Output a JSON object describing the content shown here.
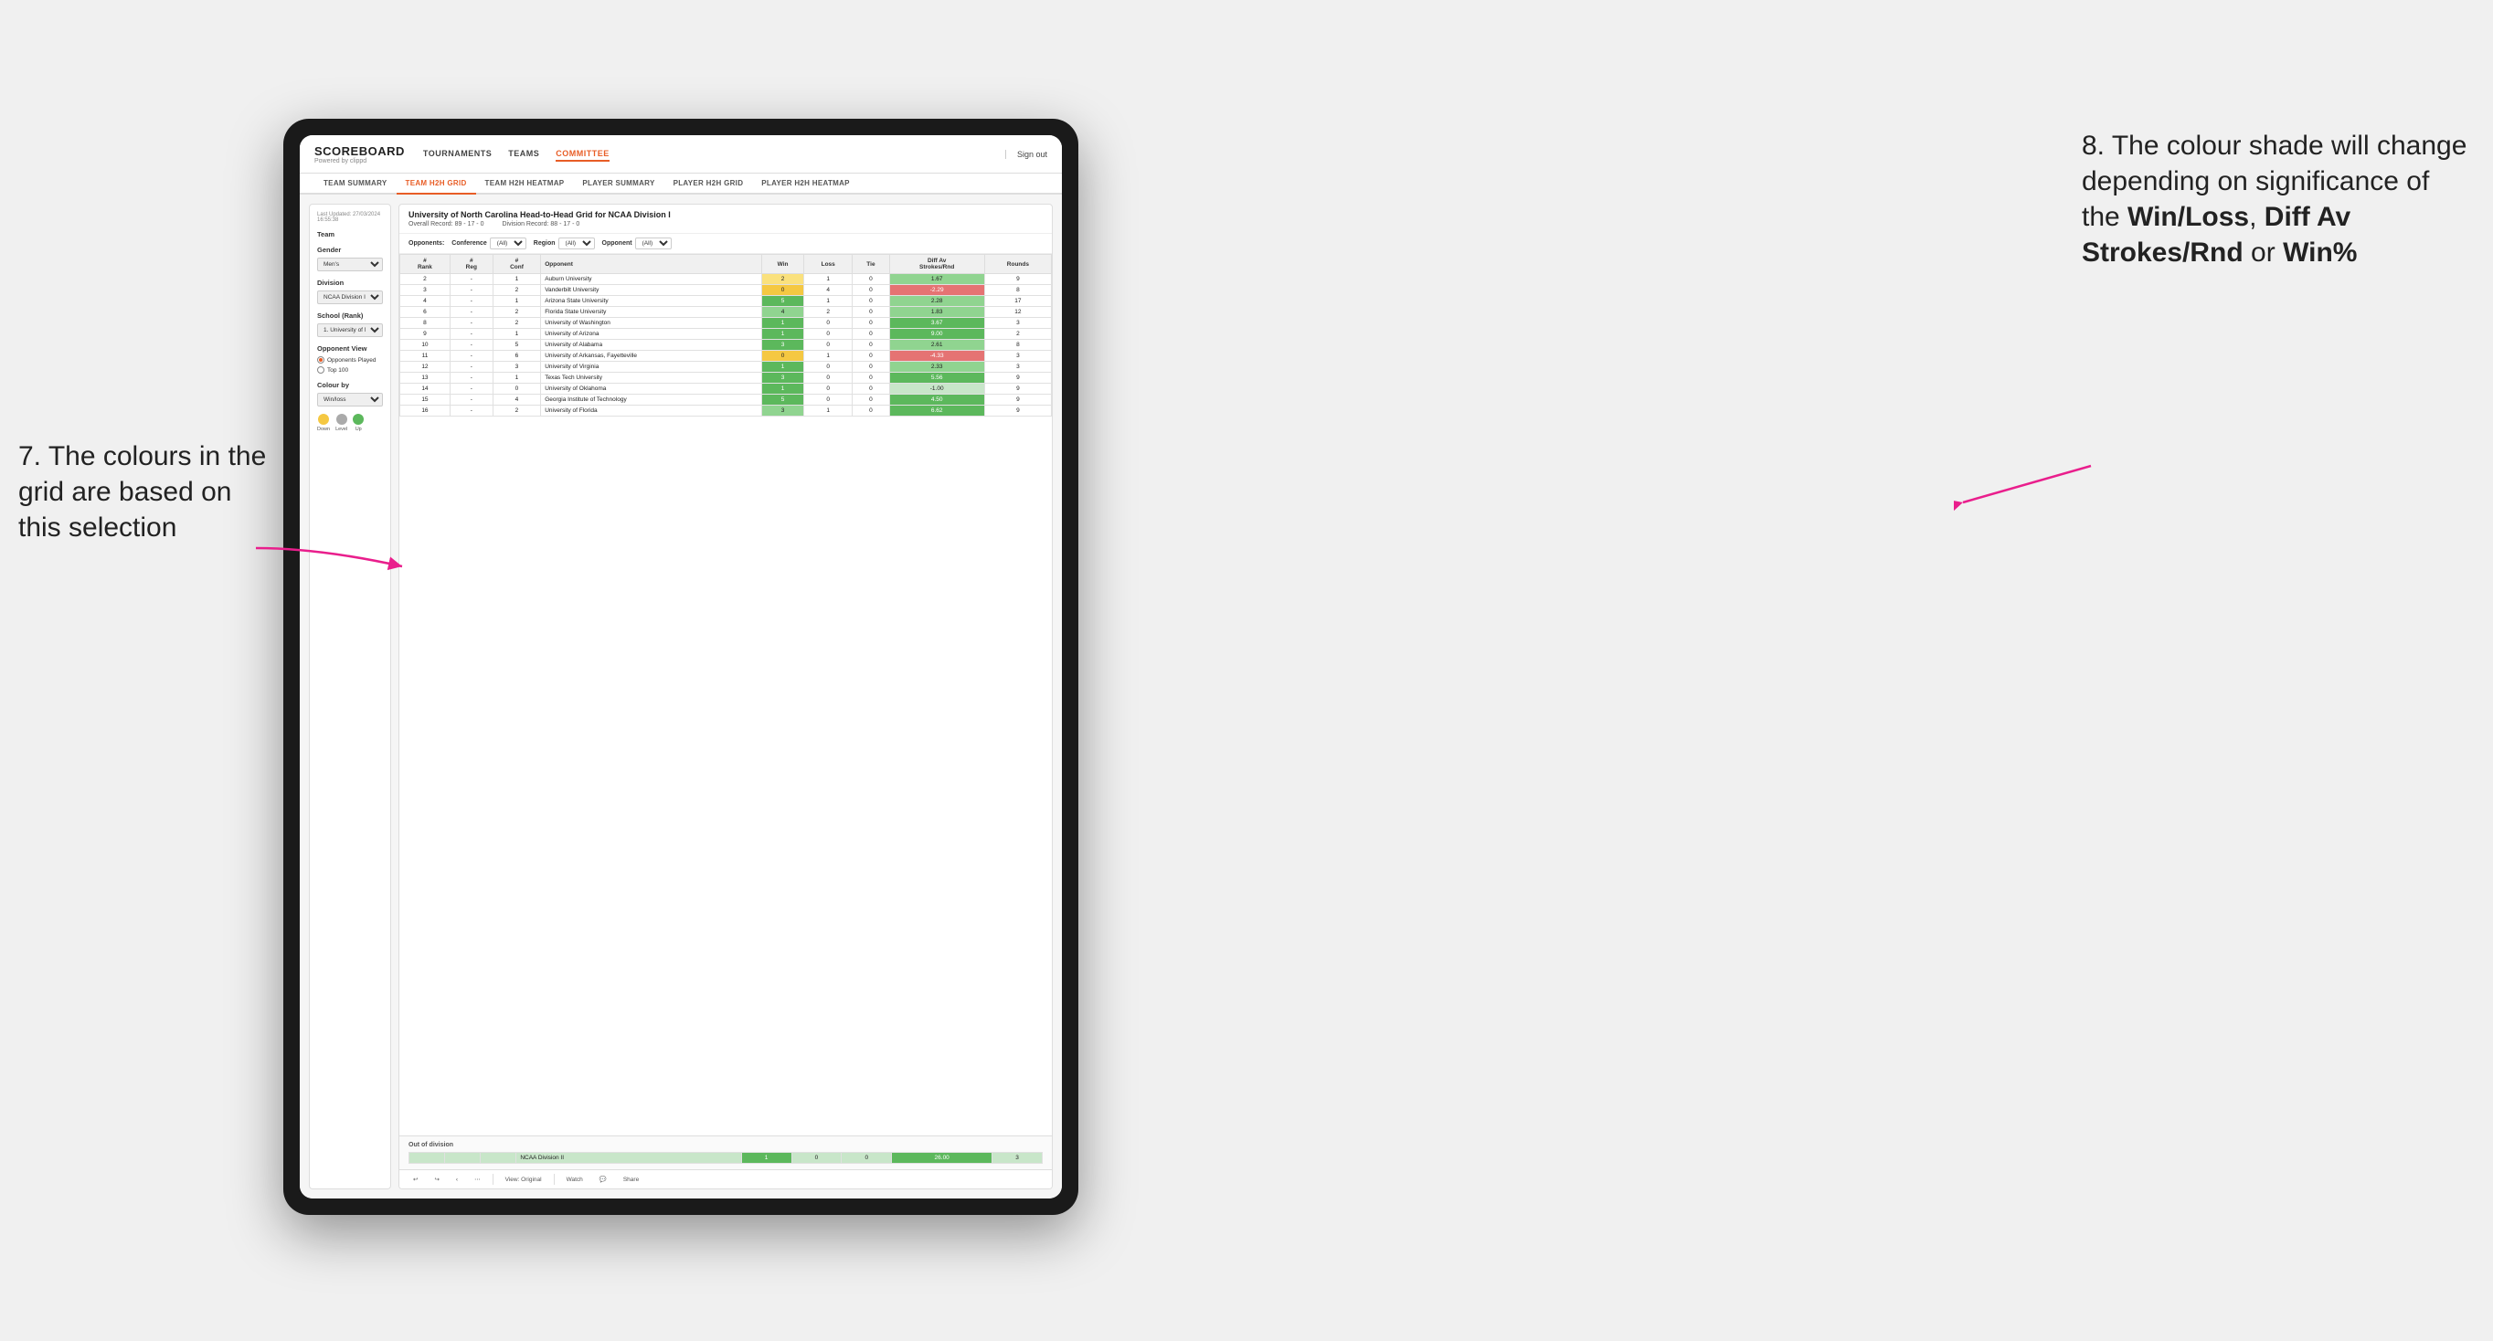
{
  "annotations": {
    "left_text": "7. The colours in the grid are based on this selection",
    "right_text_1": "8. The colour shade will change depending on significance of the ",
    "right_bold_1": "Win/Loss",
    "right_text_2": ", ",
    "right_bold_2": "Diff Av Strokes/Rnd",
    "right_text_3": " or ",
    "right_bold_3": "Win%"
  },
  "app": {
    "logo": "SCOREBOARD",
    "logo_sub": "Powered by clippd",
    "nav": [
      "TOURNAMENTS",
      "TEAMS",
      "COMMITTEE"
    ],
    "sign_out": "Sign out",
    "active_nav": "COMMITTEE",
    "tabs": [
      "TEAM SUMMARY",
      "TEAM H2H GRID",
      "TEAM H2H HEATMAP",
      "PLAYER SUMMARY",
      "PLAYER H2H GRID",
      "PLAYER H2H HEATMAP"
    ],
    "active_tab": "TEAM H2H GRID"
  },
  "sidebar": {
    "timestamp_label": "Last Updated: 27/03/2024",
    "timestamp_time": "16:55:38",
    "team_label": "Team",
    "gender_label": "Gender",
    "gender_value": "Men's",
    "division_label": "Division",
    "division_value": "NCAA Division I",
    "school_label": "School (Rank)",
    "school_value": "1. University of Nort...",
    "opponent_view_label": "Opponent View",
    "radio_options": [
      "Opponents Played",
      "Top 100"
    ],
    "selected_radio": "Opponents Played",
    "colour_by_label": "Colour by",
    "colour_by_value": "Win/loss",
    "legend": [
      {
        "label": "Down",
        "color": "#f5c842"
      },
      {
        "label": "Level",
        "color": "#aaaaaa"
      },
      {
        "label": "Up",
        "color": "#5cb85c"
      }
    ]
  },
  "grid": {
    "title": "University of North Carolina Head-to-Head Grid for NCAA Division I",
    "overall_record": "Overall Record: 89 - 17 - 0",
    "division_record": "Division Record: 88 - 17 - 0",
    "filters": {
      "opponents_label": "Opponents:",
      "conference_label": "Conference",
      "conference_value": "(All)",
      "region_label": "Region",
      "region_value": "(All)",
      "opponent_label": "Opponent",
      "opponent_value": "(All)"
    },
    "columns": [
      "#\nRank",
      "# Reg",
      "# Conf",
      "Opponent",
      "Win",
      "Loss",
      "Tie",
      "Diff Av Strokes/Rnd",
      "Rounds"
    ],
    "rows": [
      {
        "rank": "2",
        "reg": "-",
        "conf": "1",
        "opponent": "Auburn University",
        "win": "2",
        "loss": "1",
        "tie": "0",
        "diff": "1.67",
        "rounds": "9",
        "win_color": "light-yellow",
        "diff_color": "light-green"
      },
      {
        "rank": "3",
        "reg": "-",
        "conf": "2",
        "opponent": "Vanderbilt University",
        "win": "0",
        "loss": "4",
        "tie": "0",
        "diff": "-2.29",
        "rounds": "8",
        "win_color": "yellow",
        "diff_color": "red"
      },
      {
        "rank": "4",
        "reg": "-",
        "conf": "1",
        "opponent": "Arizona State University",
        "win": "5",
        "loss": "1",
        "tie": "0",
        "diff": "2.28",
        "rounds": "17",
        "win_color": "green",
        "diff_color": "light-green"
      },
      {
        "rank": "6",
        "reg": "-",
        "conf": "2",
        "opponent": "Florida State University",
        "win": "4",
        "loss": "2",
        "tie": "0",
        "diff": "1.83",
        "rounds": "12",
        "win_color": "light-green",
        "diff_color": "light-green"
      },
      {
        "rank": "8",
        "reg": "-",
        "conf": "2",
        "opponent": "University of Washington",
        "win": "1",
        "loss": "0",
        "tie": "0",
        "diff": "3.67",
        "rounds": "3",
        "win_color": "green",
        "diff_color": "green"
      },
      {
        "rank": "9",
        "reg": "-",
        "conf": "1",
        "opponent": "University of Arizona",
        "win": "1",
        "loss": "0",
        "tie": "0",
        "diff": "9.00",
        "rounds": "2",
        "win_color": "green",
        "diff_color": "green"
      },
      {
        "rank": "10",
        "reg": "-",
        "conf": "5",
        "opponent": "University of Alabama",
        "win": "3",
        "loss": "0",
        "tie": "0",
        "diff": "2.61",
        "rounds": "8",
        "win_color": "green",
        "diff_color": "light-green"
      },
      {
        "rank": "11",
        "reg": "-",
        "conf": "6",
        "opponent": "University of Arkansas, Fayetteville",
        "win": "0",
        "loss": "1",
        "tie": "0",
        "diff": "-4.33",
        "rounds": "3",
        "win_color": "yellow",
        "diff_color": "red"
      },
      {
        "rank": "12",
        "reg": "-",
        "conf": "3",
        "opponent": "University of Virginia",
        "win": "1",
        "loss": "0",
        "tie": "0",
        "diff": "2.33",
        "rounds": "3",
        "win_color": "green",
        "diff_color": "light-green"
      },
      {
        "rank": "13",
        "reg": "-",
        "conf": "1",
        "opponent": "Texas Tech University",
        "win": "3",
        "loss": "0",
        "tie": "0",
        "diff": "5.56",
        "rounds": "9",
        "win_color": "green",
        "diff_color": "green"
      },
      {
        "rank": "14",
        "reg": "-",
        "conf": "0",
        "opponent": "University of Oklahoma",
        "win": "1",
        "loss": "0",
        "tie": "0",
        "diff": "-1.00",
        "rounds": "9",
        "win_color": "green",
        "diff_color": "pale-green"
      },
      {
        "rank": "15",
        "reg": "-",
        "conf": "4",
        "opponent": "Georgia Institute of Technology",
        "win": "5",
        "loss": "0",
        "tie": "0",
        "diff": "4.50",
        "rounds": "9",
        "win_color": "green",
        "diff_color": "green"
      },
      {
        "rank": "16",
        "reg": "-",
        "conf": "2",
        "opponent": "University of Florida",
        "win": "3",
        "loss": "1",
        "tie": "0",
        "diff": "6.62",
        "rounds": "9",
        "win_color": "light-green",
        "diff_color": "green"
      }
    ],
    "out_of_division": {
      "label": "Out of division",
      "rows": [
        {
          "name": "NCAA Division II",
          "win": "1",
          "loss": "0",
          "tie": "0",
          "diff": "26.00",
          "rounds": "3"
        }
      ]
    }
  },
  "toolbar": {
    "view_label": "View: Original",
    "watch_label": "Watch",
    "share_label": "Share"
  }
}
